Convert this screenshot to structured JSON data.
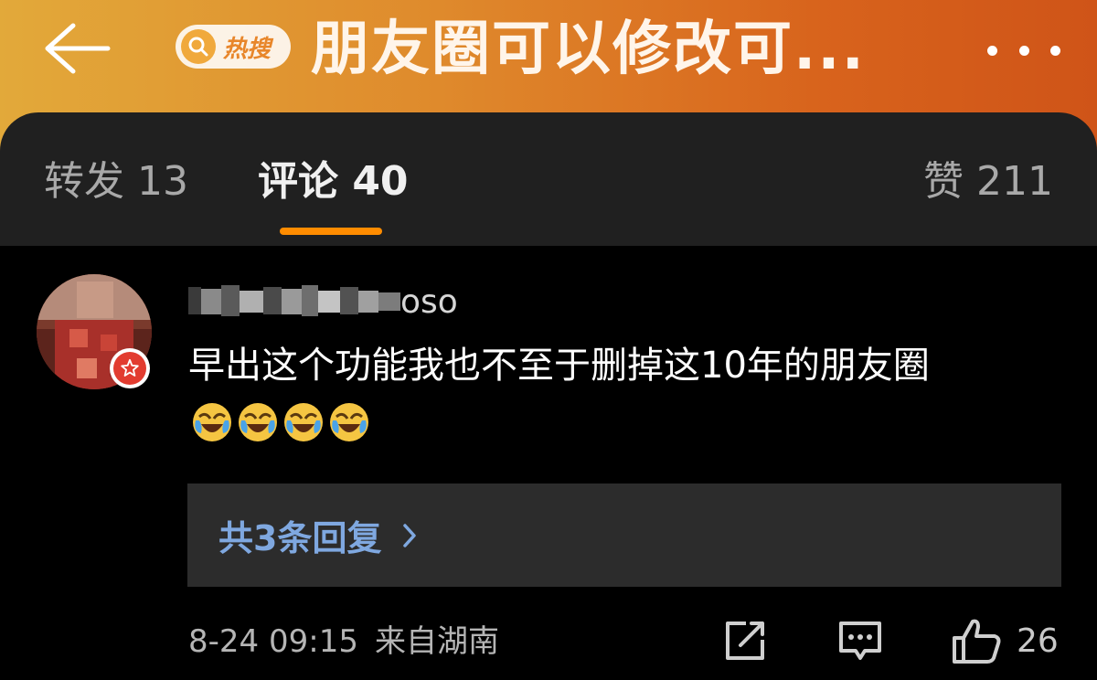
{
  "header": {
    "back_icon": "arrow-left-icon",
    "hot_badge_label": "热搜",
    "title": "朋友圈可以修改可...",
    "more_icon": "more-dots-icon"
  },
  "tabs": {
    "repost": "转发 13",
    "comments": "评论 40",
    "likes": "赞 211",
    "active": "comments",
    "accent_color": "#ff8c00"
  },
  "comment": {
    "username_visible": "oso",
    "text": "早出这个功能我也不至于删掉这10年的朋友圈",
    "emoji_icon": "laughing-crying-emoji-icon",
    "emoji_count": 4,
    "replies_label": "共3条回复",
    "timestamp": "8-24 09:15",
    "location": "来自湖南",
    "like_count": "26",
    "badge_icon": "star-badge-icon"
  }
}
